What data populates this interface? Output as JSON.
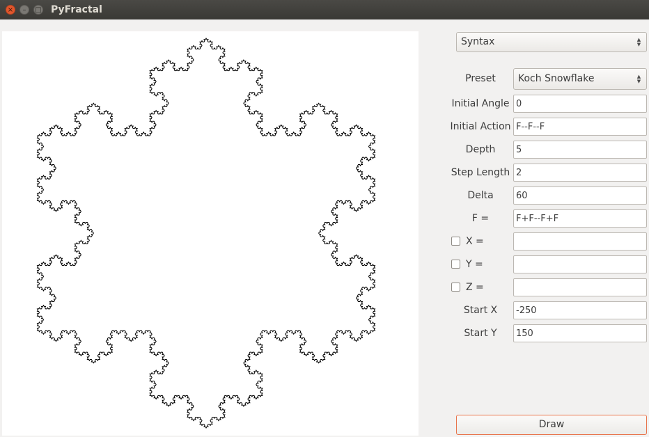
{
  "window": {
    "title": "PyFractal",
    "close_glyph": "×",
    "minimize_glyph": "–",
    "maximize_glyph": "□"
  },
  "mode_select": {
    "value": "Syntax"
  },
  "form": {
    "preset_label": "Preset",
    "preset_value": "Koch Snowflake",
    "initial_angle_label": "Initial Angle",
    "initial_angle_value": "0",
    "initial_action_label": "Initial Action",
    "initial_action_value": "F--F--F",
    "depth_label": "Depth",
    "depth_value": "5",
    "step_length_label": "Step Length",
    "step_length_value": "2",
    "delta_label": "Delta",
    "delta_value": "60",
    "f_rule_label": "F =",
    "f_rule_value": "F+F--F+F",
    "x_rule_label": "X =",
    "x_rule_value": "",
    "x_rule_checked": false,
    "y_rule_label": "Y =",
    "y_rule_value": "",
    "y_rule_checked": false,
    "z_rule_label": "Z =",
    "z_rule_value": "",
    "z_rule_checked": false,
    "start_x_label": "Start X",
    "start_x_value": "-250",
    "start_y_label": "Start Y",
    "start_y_value": "150"
  },
  "draw_button": {
    "label": "Draw"
  },
  "colors": {
    "accent": "#e8744b",
    "titlebar": "#3c3b37",
    "close_button": "#e2572d",
    "fractal_stroke": "#000000"
  },
  "icons": {
    "close": "close-icon",
    "minimize": "minimize-icon",
    "maximize": "maximize-icon",
    "combo_arrows": "updown-chevron-icon"
  }
}
